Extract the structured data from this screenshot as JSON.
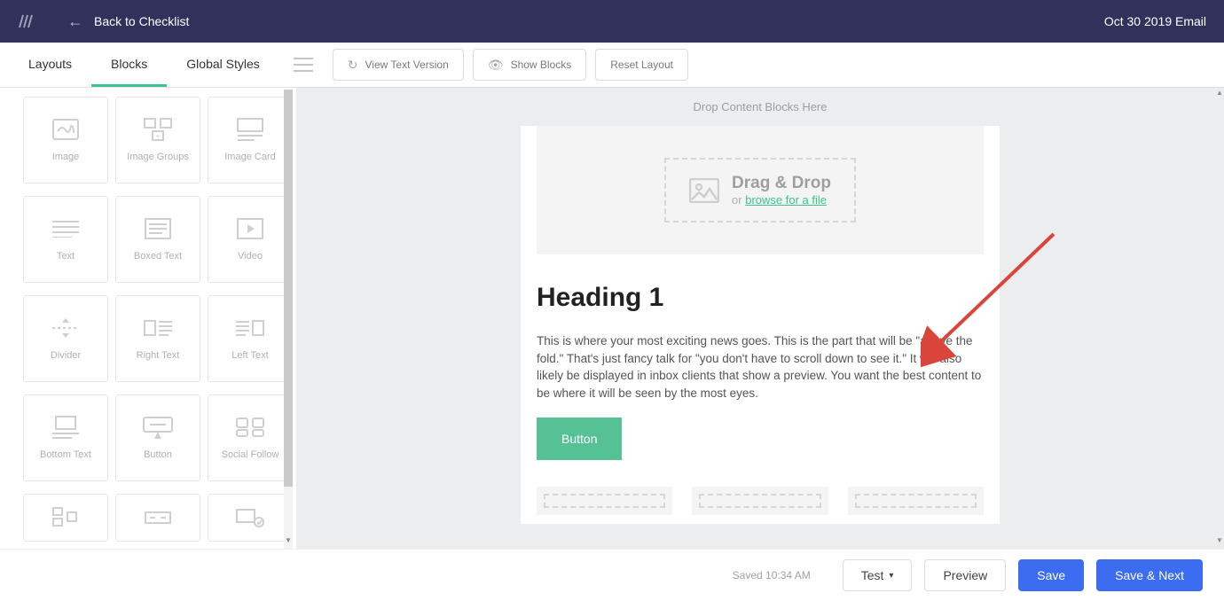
{
  "header": {
    "back_label": "Back to Checklist",
    "page_title": "Oct 30 2019 Email"
  },
  "tabs": {
    "layouts": "Layouts",
    "blocks": "Blocks",
    "global_styles": "Global Styles"
  },
  "toolbar": {
    "view_text": "View Text Version",
    "show_blocks": "Show Blocks",
    "reset_layout": "Reset Layout"
  },
  "blocks": {
    "image": "Image",
    "image_groups": "Image Groups",
    "image_card": "Image Card",
    "text": "Text",
    "boxed_text": "Boxed Text",
    "video": "Video",
    "divider": "Divider",
    "right_text": "Right Text",
    "left_text": "Left Text",
    "bottom_text": "Bottom Text",
    "button": "Button",
    "social_follow": "Social Follow"
  },
  "canvas": {
    "drop_hint": "Drop Content Blocks Here",
    "drag_drop": "Drag & Drop",
    "or_text": "or ",
    "browse": "browse for a file",
    "heading": "Heading 1",
    "paragraph": "This is where your most exciting news goes. This is the part that will be \"above the fold.\" That's just fancy talk for \"you don't have to scroll down to see it.\" It will also likely be displayed in inbox clients that show a preview. You want the best content to be where it will be seen by the most eyes.",
    "button": "Button"
  },
  "footer": {
    "saved": "Saved 10:34 AM",
    "test": "Test",
    "preview": "Preview",
    "save": "Save",
    "save_next": "Save & Next"
  },
  "colors": {
    "accent_green": "#3bc48c",
    "primary_blue": "#3c6cf0",
    "header_bg": "#31315b",
    "arrow_red": "#d9453a"
  }
}
